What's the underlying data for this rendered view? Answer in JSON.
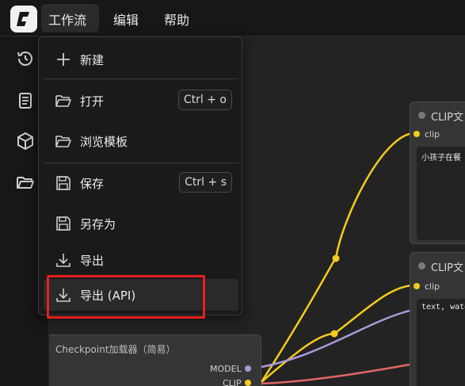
{
  "menubar": {
    "workflow": "工作流",
    "edit": "编辑",
    "help": "帮助"
  },
  "sidebar": {
    "icons": [
      "history-icon",
      "queue-icon",
      "model-library-icon",
      "workflows-folder-icon"
    ]
  },
  "dropdown": {
    "items": [
      {
        "label": "新建",
        "icon": "plus-icon"
      },
      {
        "label": "打开",
        "icon": "folder-open-icon",
        "shortcut": "Ctrl + o"
      },
      {
        "label": "浏览模板",
        "icon": "folder-open-icon"
      },
      {
        "label": "保存",
        "icon": "save-icon",
        "shortcut": "Ctrl + s"
      },
      {
        "label": "另存为",
        "icon": "save-icon"
      },
      {
        "label": "导出",
        "icon": "download-icon"
      },
      {
        "label": "导出 (API)",
        "icon": "download-icon"
      }
    ]
  },
  "canvas": {
    "node_clip1": {
      "title": "CLIP文",
      "input": "clip",
      "text": "小孩子在餐"
    },
    "node_clip2": {
      "title": "CLIP文",
      "input": "clip",
      "text": "text, water"
    },
    "node_checkpoint": {
      "title": "Checkpoint加载器（简易）",
      "out_model": "MODEL",
      "out_clip": "CLIP"
    }
  },
  "colors": {
    "accent_yellow": "#f5cc1e",
    "wire_purple": "#a89bd8",
    "wire_red": "#e06666",
    "highlight_red": "#e52020"
  }
}
